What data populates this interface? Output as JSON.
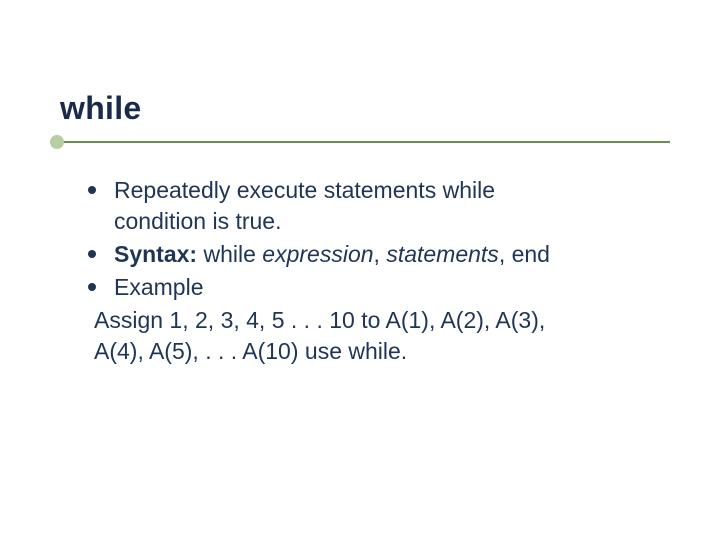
{
  "slide": {
    "title": "while",
    "bullets": [
      {
        "lines": [
          "Repeatedly execute statements while",
          "condition is true."
        ]
      },
      {
        "segments": [
          {
            "text": "Syntax:",
            "bold": true
          },
          {
            "text": " while "
          },
          {
            "text": "expression",
            "italic": true
          },
          {
            "text": ", "
          },
          {
            "text": "statements",
            "italic": true
          },
          {
            "text": ", end"
          }
        ]
      },
      {
        "lines": [
          "Example"
        ]
      }
    ],
    "sub_lines": [
      "Assign 1, 2, 3, 4, 5 . . . 10 to A(1), A(2), A(3),",
      "A(4), A(5), . . . A(10) use while."
    ]
  }
}
